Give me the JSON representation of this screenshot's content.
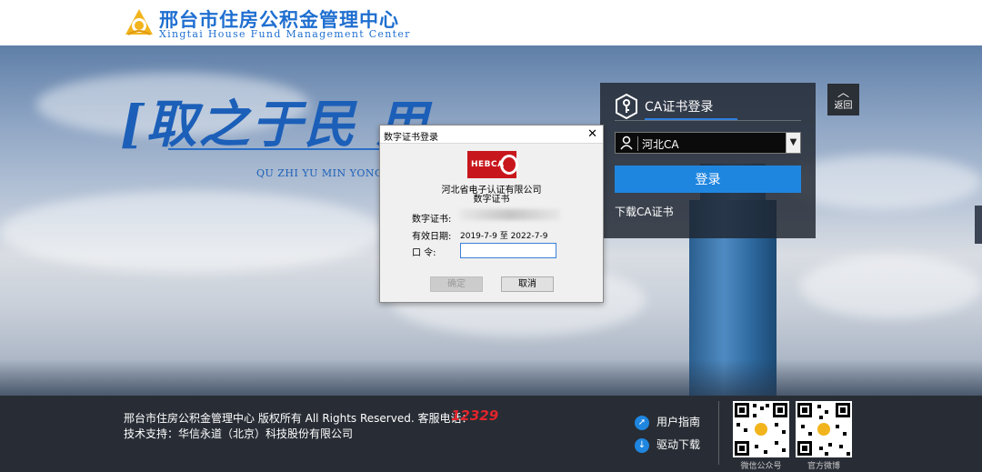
{
  "header": {
    "brand_cn": "邢台市住房公积金管理中心",
    "brand_en": "Xingtai House Fund Management Center",
    "logo_icon": "gold-coin-logo-icon"
  },
  "banner": {
    "calligraphy": "[取之于民 用",
    "pinyin": "QU ZHI YU MIN YONG ZI"
  },
  "return_button": {
    "label": "返回",
    "icon": "chevron-up-icon"
  },
  "ca_panel": {
    "title": "CA证书登录",
    "key_icon": "key-icon",
    "select_value": "河北CA",
    "login_label": "登录",
    "download_label": "下载CA证书"
  },
  "dialog": {
    "title": "数字证书登录",
    "close_glyph": "✕",
    "logo_text": "HEBCA",
    "company": "河北省电子认证有限公司",
    "cert_heading": "数字证书",
    "cert_label": "数字证书:",
    "valid_label": "有效日期:",
    "valid_value": "2019-7-9  至  2022-7-9",
    "password_label": "口    令:",
    "password_value": "",
    "ok_label": "确定",
    "cancel_label": "取消"
  },
  "footer": {
    "copyright": "邢台市住房公积金管理中心 版权所有 All Rights Reserved.   客服电话：",
    "phone": "12329",
    "support": "技术支持：华信永道（北京）科技股份有限公司",
    "guide_label": "用户指南",
    "driver_label": "驱动下载",
    "qr1_label": "微信公众号",
    "qr2_label": "官方微博"
  },
  "colors": {
    "brand_blue": "#1f6fd0",
    "accent_blue": "#1f86e0",
    "phone_red": "#e3242b"
  }
}
